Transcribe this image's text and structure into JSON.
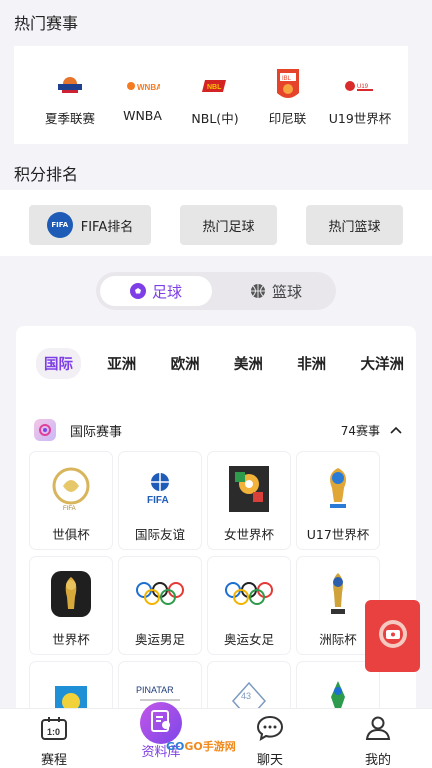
{
  "hot": {
    "title": "热门赛事",
    "items": [
      {
        "label": "夏季联赛",
        "icon": "summer-league-logo-icon"
      },
      {
        "label": "WNBA",
        "icon": "wnba-logo-icon"
      },
      {
        "label": "NBL(中)",
        "icon": "nbl-logo-icon"
      },
      {
        "label": "印尼联",
        "icon": "indonesian-league-logo-icon"
      },
      {
        "label": "U19世界杯",
        "icon": "u19-world-cup-logo-icon"
      }
    ]
  },
  "ranking": {
    "title": "积分排名",
    "buttons": [
      "FIFA排名",
      "热门足球",
      "热门篮球"
    ]
  },
  "toggle": {
    "active": "足球",
    "other": "篮球"
  },
  "regions": [
    "国际",
    "亚洲",
    "欧洲",
    "美洲",
    "非洲",
    "大洋洲"
  ],
  "category": {
    "name": "国际赛事",
    "count": "74赛事"
  },
  "competitions": [
    {
      "label": "世俱杯",
      "icon": "club-world-cup-logo-icon"
    },
    {
      "label": "国际友谊",
      "icon": "fifa-logo-icon"
    },
    {
      "label": "女世界杯",
      "icon": "womens-world-cup-logo-icon"
    },
    {
      "label": "U17世界杯",
      "icon": "u17-world-cup-logo-icon"
    },
    {
      "label": "世界杯",
      "icon": "world-cup-logo-icon"
    },
    {
      "label": "奥运男足",
      "icon": "olympic-rings-icon"
    },
    {
      "label": "奥运女足",
      "icon": "olympic-rings-icon"
    },
    {
      "label": "洲际杯",
      "icon": "intercontinental-cup-logo-icon"
    },
    {
      "label": "",
      "icon": "tournament-logo-icon"
    },
    {
      "label": "",
      "icon": "pinatar-cup-logo-icon"
    },
    {
      "label": "",
      "icon": "festival-logo-icon"
    },
    {
      "label": "",
      "icon": "tournament-logo-icon"
    }
  ],
  "tabs": {
    "schedule": "赛程",
    "data": "资料库",
    "chat": "聊天",
    "mine": "我的"
  },
  "watermark": {
    "blue": "GO",
    "orange": "GO手游网"
  },
  "colors": {
    "accent": "#7e3fe6",
    "red_packet": "#e8413f"
  }
}
